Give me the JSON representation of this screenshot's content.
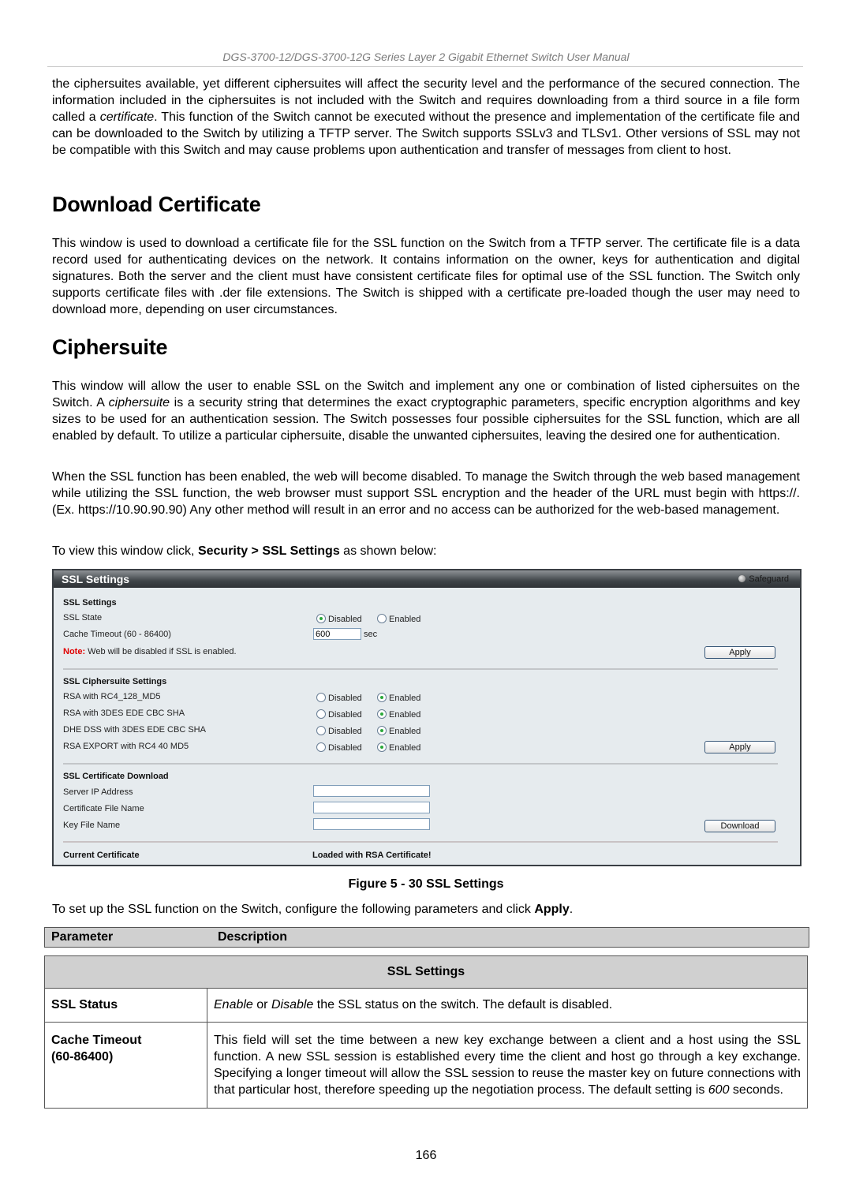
{
  "header": {
    "running_title": "DGS-3700-12/DGS-3700-12G Series Layer 2 Gigabit Ethernet Switch User Manual"
  },
  "intro_paragraph": {
    "before_italic": "the ciphersuites available, yet different ciphersuites will affect the security level and the performance of the secured connection. The information included in the ciphersuites is not included with the Switch and requires downloading from a third source in a file form called a ",
    "italic": "certificate",
    "after_italic": ". This function of the Switch cannot be executed without the presence and implementation of the certificate file and can be downloaded to the Switch by utilizing a TFTP server. The Switch supports SSLv3 and TLSv1. Other versions of SSL may not be compatible with this Switch and may cause problems upon authentication and transfer of messages from client to host."
  },
  "download_certificate": {
    "heading": "Download Certificate",
    "body": "This window is used to download a certificate file for the SSL function on the Switch from a TFTP server. The certificate file is a data record used for authenticating devices on the network. It contains information on the owner, keys for authentication and digital signatures. Both the server and the client must have consistent certificate files for optimal use of the SSL function. The Switch only supports certificate files with .der file extensions. The Switch is shipped with a certificate pre-loaded though the user may need to download more, depending on user circumstances."
  },
  "ciphersuite": {
    "heading": "Ciphersuite",
    "p1_before": "This window will allow the user to enable SSL on the Switch and implement any one or combination of listed ciphersuites on the Switch. A ",
    "p1_italic": "ciphersuite",
    "p1_after": " is a security string that determines the exact cryptographic parameters, specific encryption algorithms and key sizes to be used for an authentication session. The Switch possesses four possible ciphersuites for the SSL function, which are all enabled by default. To utilize a particular ciphersuite, disable the unwanted ciphersuites, leaving the desired one for authentication.",
    "p2": "When the SSL function has been enabled, the web will become disabled. To manage the Switch through the web based management while utilizing the SSL function, the web browser must support SSL encryption and the header of the URL must begin with https://. (Ex. https://10.90.90.90) Any other method will result in an error and no access can be authorized for the web-based management.",
    "p3_before": "To view this window click, ",
    "p3_bold": "Security > SSL Settings",
    "p3_after": " as shown below:"
  },
  "panel": {
    "title": "SSL Settings",
    "safeguard": "Safeguard",
    "ssl_settings": {
      "section_title": "SSL Settings",
      "state_label": "SSL State",
      "state_options": [
        "Disabled",
        "Enabled"
      ],
      "state_selected": "Disabled",
      "cache_label": "Cache Timeout (60 - 86400)",
      "cache_value": "600",
      "cache_unit": "sec",
      "note_prefix": "Note:",
      "note_text": " Web will be disabled if SSL is enabled.",
      "apply_label": "Apply"
    },
    "ciphersuite_settings": {
      "section_title": "SSL Ciphersuite Settings",
      "disabled_label": "Disabled",
      "enabled_label": "Enabled",
      "rows": [
        {
          "name": "RSA with RC4_128_MD5",
          "selected": "Enabled"
        },
        {
          "name": "RSA with 3DES EDE CBC SHA",
          "selected": "Enabled"
        },
        {
          "name": "DHE DSS with 3DES EDE CBC SHA",
          "selected": "Enabled"
        },
        {
          "name": "RSA EXPORT with RC4 40 MD5",
          "selected": "Enabled"
        }
      ],
      "apply_label": "Apply"
    },
    "certificate_download": {
      "section_title": "SSL Certificate Download",
      "server_ip_label": "Server IP Address",
      "server_ip_value": "",
      "cert_file_label": "Certificate File Name",
      "cert_file_value": "",
      "key_file_label": "Key File Name",
      "key_file_value": "",
      "download_label": "Download"
    },
    "current_certificate": {
      "label": "Current Certificate",
      "value": "Loaded with RSA Certificate!"
    }
  },
  "figure_caption": "Figure 5 - 30 SSL Settings",
  "setup_sentence": {
    "before": "To set up the SSL function on the Switch, configure the following parameters and click ",
    "bold": "Apply",
    "after": "."
  },
  "param_table": {
    "headers": [
      "Parameter",
      "Description"
    ],
    "section": "SSL Settings",
    "rows": [
      {
        "param": "SSL Status",
        "desc_i1": "Enable",
        "desc_m1": " or ",
        "desc_i2": "Disable",
        "desc_rest": " the SSL status on the switch. The default is disabled."
      },
      {
        "param_line1": "Cache Timeout",
        "param_line2": "(60-86400)",
        "desc_before": "This field will set the time between a new key exchange between a client and a host using the SSL function. A new SSL session is established every time the client and host go through a key exchange. Specifying a longer timeout will allow the SSL session to reuse the master key on future connections with that particular host, therefore speeding up the negotiation process. The default setting is ",
        "desc_italic": "600",
        "desc_after": " seconds."
      }
    ]
  },
  "page_number": "166"
}
